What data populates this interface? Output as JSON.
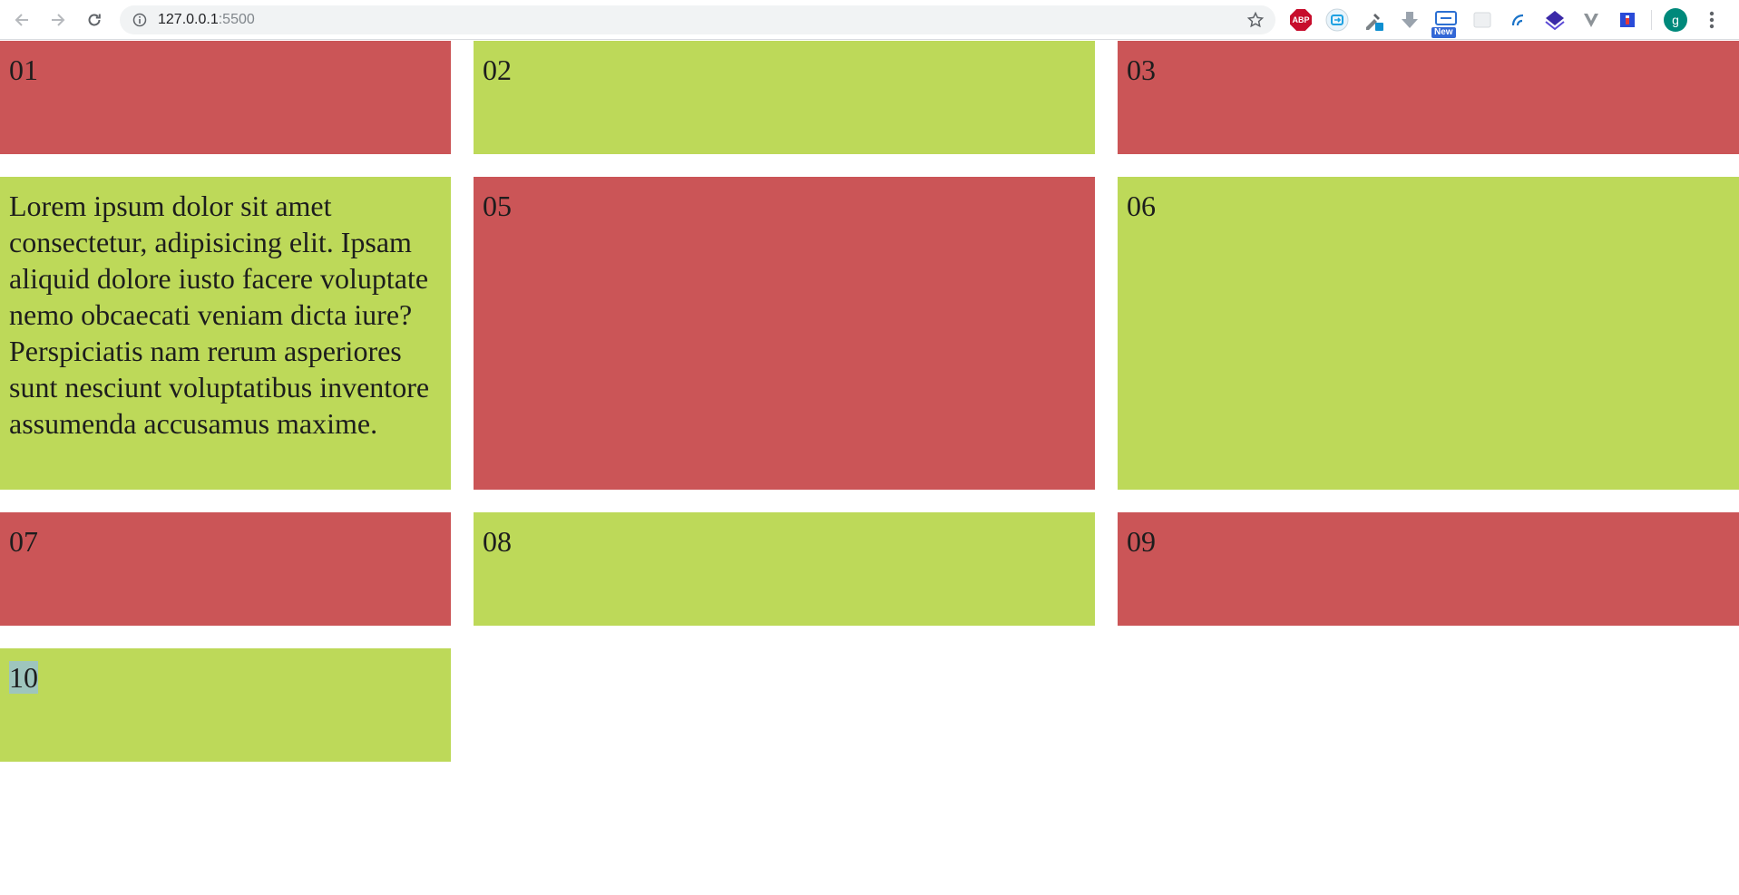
{
  "browser": {
    "url_host": "127.0.0.1",
    "url_port": ":5500",
    "extensions": [
      "abp-icon",
      "screen-capture-icon",
      "eyedropper-icon",
      "download-arrow-icon",
      "new-extension-icon",
      "blank-extension-icon",
      "curl-extension-icon",
      "purple-stack-icon",
      "v-extension-icon",
      "flag-extension-icon"
    ],
    "extension_badge_new": "New",
    "extension_abp_label": "ABP",
    "profile_initial": "g"
  },
  "colors": {
    "red": "#cb5557",
    "green": "#bdd959",
    "highlight": "#9ec5bd"
  },
  "grid": {
    "cells": [
      {
        "label": "01",
        "color": "red"
      },
      {
        "label": "02",
        "color": "green"
      },
      {
        "label": "03",
        "color": "red"
      },
      {
        "label": "Lorem ipsum dolor sit amet consectetur, adipisicing elit. Ipsam aliquid dolore iusto facere voluptate nemo obcaecati veniam dicta iure? Perspiciatis nam rerum asperiores sunt nesciunt voluptatibus inventore assumenda accusamus maxime.",
        "color": "green"
      },
      {
        "label": "05",
        "color": "red"
      },
      {
        "label": "06",
        "color": "green"
      },
      {
        "label": "07",
        "color": "red"
      },
      {
        "label": "08",
        "color": "green"
      },
      {
        "label": "09",
        "color": "red"
      },
      {
        "label": "10",
        "color": "green"
      }
    ]
  }
}
